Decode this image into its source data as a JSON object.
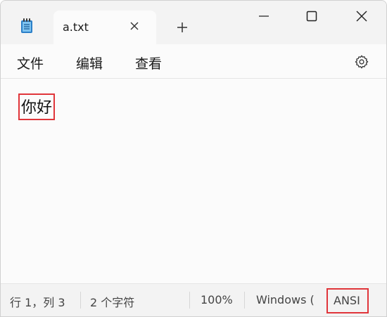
{
  "tabs": [
    {
      "title": "a.txt"
    }
  ],
  "menu": {
    "file": "文件",
    "edit": "编辑",
    "view": "查看"
  },
  "editor": {
    "content": "你好"
  },
  "status": {
    "position": "行 1，列 3",
    "char_count": "2 个字符",
    "zoom": "100%",
    "line_ending": "Windows (",
    "encoding": "ANSI"
  },
  "icons": {
    "app": "notepad-icon",
    "close_tab": "close-icon",
    "new_tab": "plus-icon",
    "minimize": "minimize-icon",
    "maximize": "maximize-icon",
    "close_window": "close-icon",
    "settings": "gear-icon"
  },
  "colors": {
    "highlight": "#e0353a",
    "app_icon": "#2b7fc8"
  }
}
